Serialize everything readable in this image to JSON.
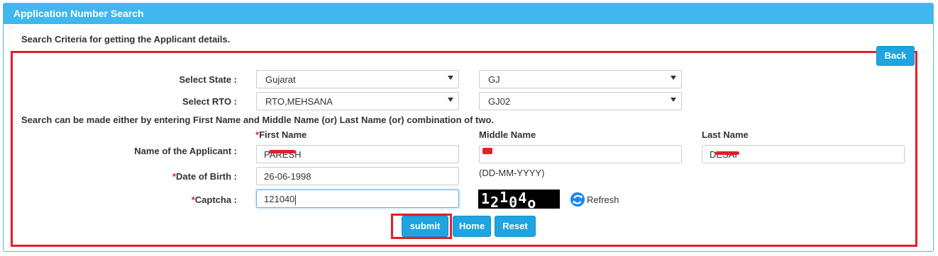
{
  "panel": {
    "title": "Application Number Search",
    "criteria_text": "Search Criteria for getting the Applicant details.",
    "back_label": "Back"
  },
  "state": {
    "label": "Select State :",
    "name_value": "Gujarat",
    "code_value": "GJ"
  },
  "rto": {
    "label": "Select RTO :",
    "name_value": "RTO,MEHSANA",
    "code_value": "GJ02"
  },
  "info_text": "Search can be made either by entering First Name and Middle Name (or) Last Name (or) combination of two.",
  "applicant": {
    "label": "Name of the Applicant :",
    "first_name_header": "First Name",
    "middle_name_header": "Middle Name",
    "last_name_header": "Last Name",
    "first_name_value": "PARESH",
    "middle_name_value": "",
    "last_name_value": "DESAI"
  },
  "dob": {
    "label": "Date of Birth :",
    "value": "26-06-1998",
    "format_hint": "(DD-MM-YYYY)"
  },
  "captcha": {
    "label": "Captcha :",
    "value": "121040",
    "image_chars": [
      "1",
      "2",
      "1",
      "0",
      "4",
      "o"
    ],
    "refresh_label": "Refresh"
  },
  "buttons": {
    "submit": "submit",
    "home": "Home",
    "reset": "Reset"
  },
  "colors": {
    "header": "#40b7ee",
    "button": "#1ea4e0",
    "highlight": "#e0202a",
    "required": "#d9232d"
  }
}
